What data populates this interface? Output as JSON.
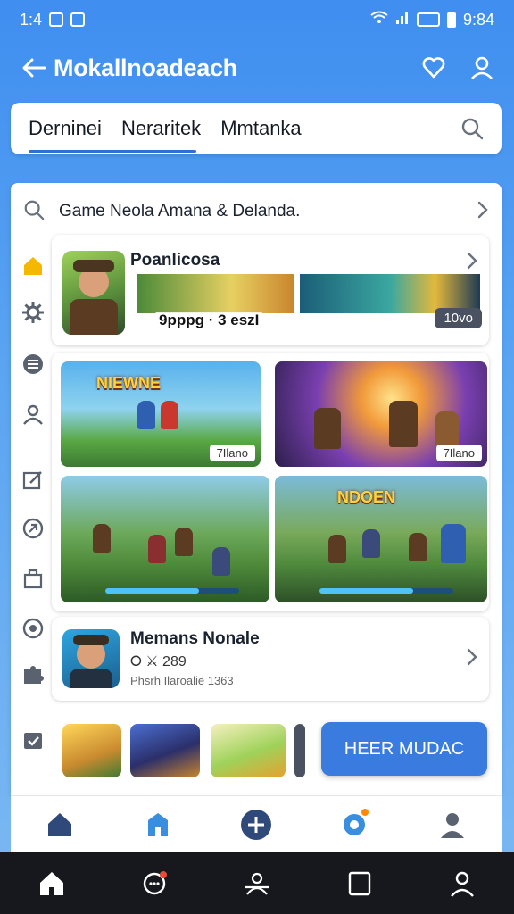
{
  "status_bar": {
    "time": "1:4",
    "right_time": "9:84"
  },
  "header": {
    "title": "Mokallnoadeach"
  },
  "tabs": [
    {
      "label": "Derninei",
      "active": true
    },
    {
      "label": "Neraritek",
      "active": false
    },
    {
      "label": "Mmtanka",
      "active": false
    }
  ],
  "search": {
    "text": "Game Neola Amana & Delanda."
  },
  "featured": {
    "title": "Poanlicosa",
    "meta": "9pppg · 3 eszI",
    "pill": "10vo"
  },
  "grid": [
    {
      "overlay": "NIEWNE",
      "tag": "7Ilano"
    },
    {
      "overlay": "",
      "tag": "7Ilano"
    },
    {
      "overlay": "",
      "tag": ""
    },
    {
      "overlay": "NDOEN",
      "tag": ""
    }
  ],
  "list_item": {
    "name": "Memans Nonale",
    "rating": "289",
    "subtitle": "Phsrh Ilaroalie 1363"
  },
  "cta": {
    "label": "HEER MUDAC"
  },
  "colors": {
    "accent": "#3a7be0",
    "header_bg": "#3f8ef0",
    "nav_dark": "#16181d"
  },
  "icons": {
    "header": [
      "back-arrow-icon",
      "heart-icon",
      "profile-icon"
    ],
    "rail": [
      "home-icon",
      "gear-icon",
      "list-icon",
      "user-icon",
      "edit-icon",
      "shield-icon",
      "bag-icon",
      "target-icon",
      "puzzle-icon",
      "check-icon"
    ],
    "app_nav": [
      "home-icon",
      "games-icon",
      "add-icon",
      "settings-icon",
      "profile-icon"
    ],
    "sys_nav": [
      "home-icon",
      "chat-icon",
      "people-icon",
      "square-icon",
      "person-icon"
    ]
  }
}
